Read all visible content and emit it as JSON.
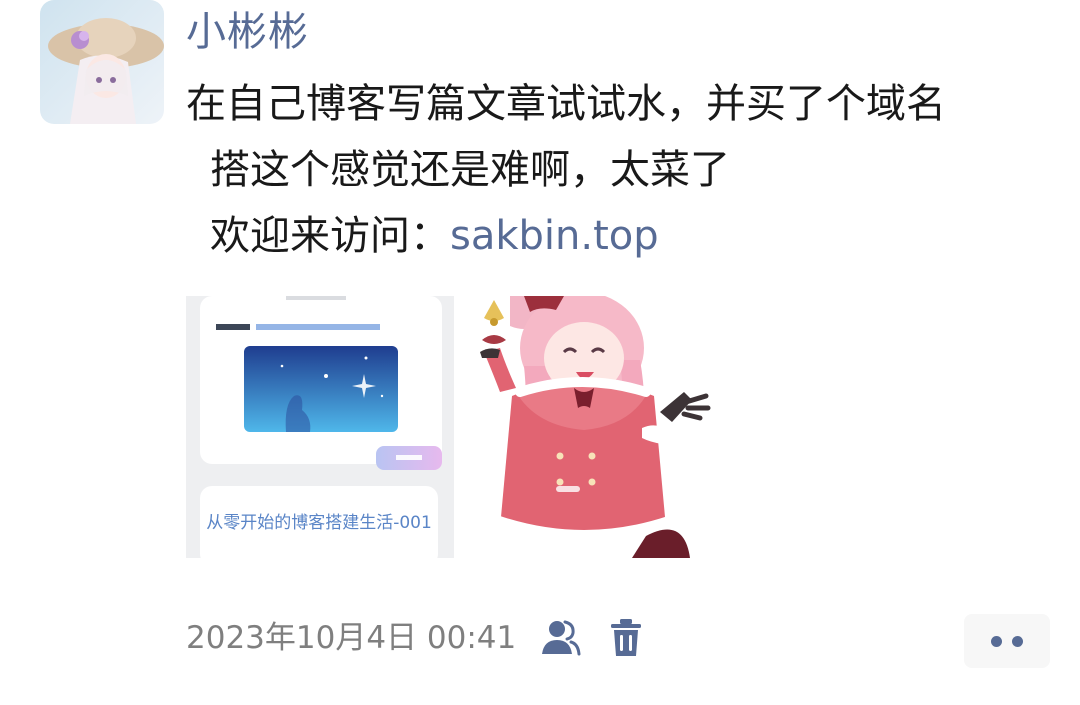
{
  "post": {
    "author": "小彬彬",
    "text_lines": [
      "在自己博客写篇文章试试水，并买了个域名",
      "搭这个感觉还是难啊，太菜了"
    ],
    "welcome_prefix": "欢迎来访问：",
    "link": "sakbin.top",
    "images": [
      {
        "kind": "blog-screenshot",
        "caption_title": "从零开始的博客搭建生活-001"
      },
      {
        "kind": "anime-illustration"
      }
    ],
    "timestamp": "2023年10月4日 00:41"
  },
  "icons": {
    "privacy": "users-icon",
    "delete": "trash-icon",
    "more": "more-dots-icon"
  },
  "colors": {
    "link": "#576b95",
    "text": "#191919",
    "meta": "#7f7f7f",
    "more_bg": "#f7f7f7"
  }
}
